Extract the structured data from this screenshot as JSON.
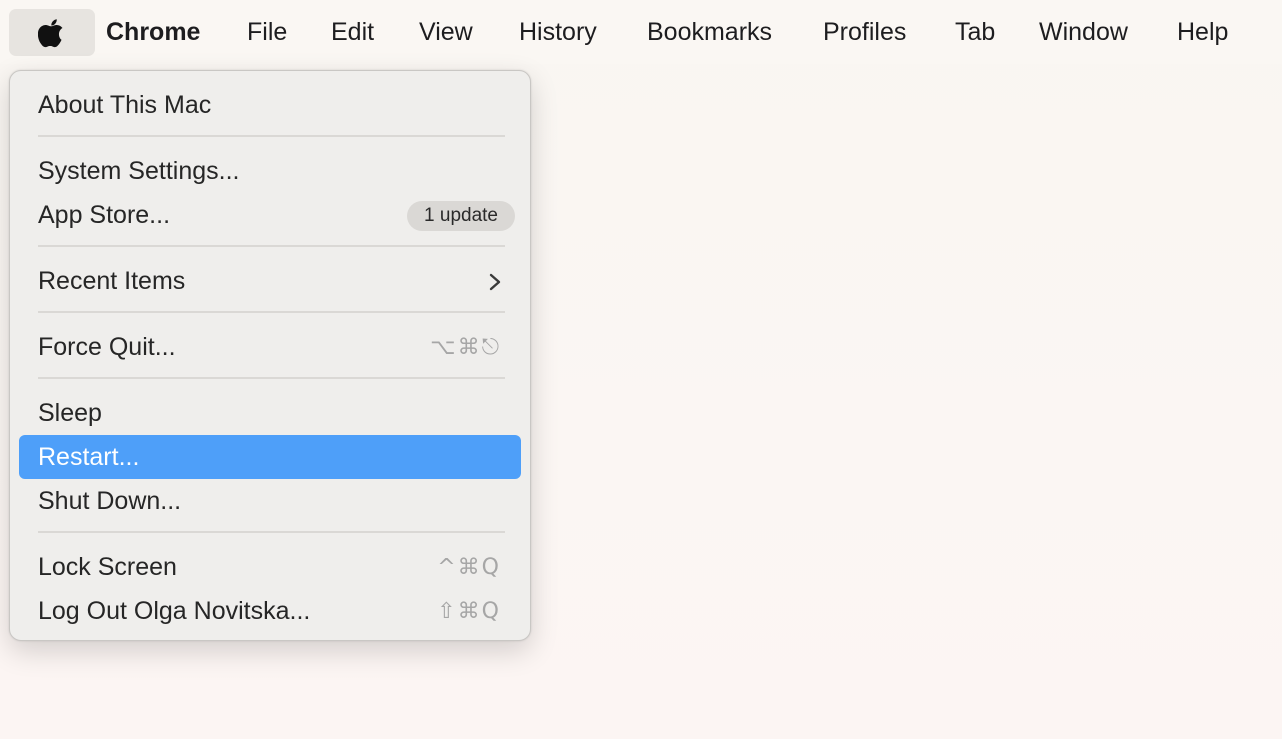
{
  "menubar": {
    "apple_icon": "apple-logo-icon",
    "app_name": "Chrome",
    "items": [
      "File",
      "Edit",
      "View",
      "History",
      "Bookmarks",
      "Profiles",
      "Tab",
      "Window",
      "Help"
    ]
  },
  "apple_menu": {
    "about": "About This Mac",
    "system_settings": "System Settings...",
    "app_store": "App Store...",
    "app_store_badge": "1 update",
    "recent_items": "Recent Items",
    "recent_items_icon": "chevron-right-icon",
    "force_quit": "Force Quit...",
    "force_quit_shortcut": "⌥⌘⎋",
    "sleep": "Sleep",
    "restart": "Restart...",
    "shut_down": "Shut Down...",
    "lock_screen": "Lock Screen",
    "lock_screen_shortcut": "^⌘Q",
    "log_out": "Log Out Olga Novitska...",
    "log_out_shortcut": "⇧⌘Q",
    "highlighted_item": "Restart..."
  },
  "colors": {
    "highlight": "#4e9ff9",
    "menu_background": "#efeeec",
    "desktop_background": "#faf6f3",
    "shortcut_text": "#a6a6a6"
  }
}
